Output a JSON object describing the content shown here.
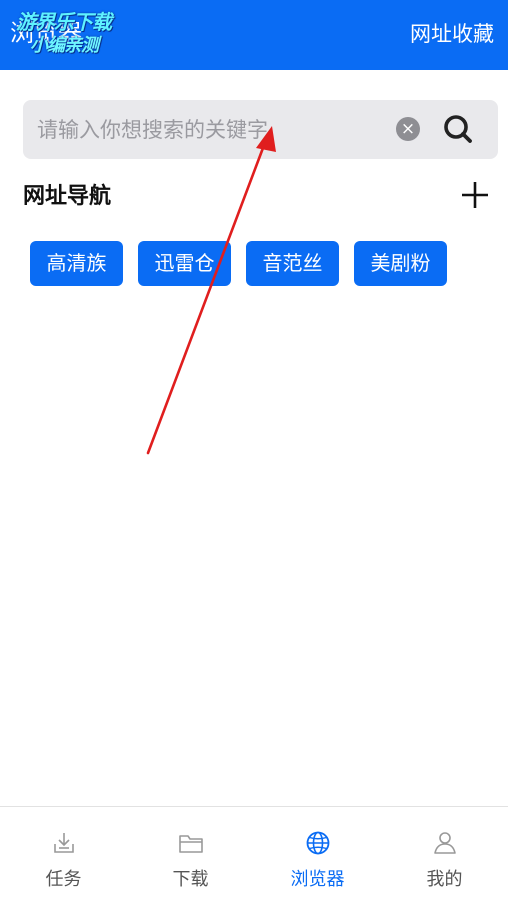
{
  "colors": {
    "accent": "#0a6cf4",
    "search_bg": "#e9e9ec",
    "arrow": "#e01e1e"
  },
  "header": {
    "title": "浏览器",
    "bookmark_label": "网址收藏",
    "watermark_line1": "游界乐下载",
    "watermark_line2": "小编亲测"
  },
  "search": {
    "placeholder": "请输入你想搜索的关键字",
    "value": "",
    "clear_icon": "clear-circle-icon",
    "search_icon": "magnifier-icon"
  },
  "nav": {
    "title": "网址导航",
    "add_icon": "plus-icon",
    "chips": [
      {
        "label": "高清族"
      },
      {
        "label": "迅雷仓"
      },
      {
        "label": "音范丝"
      },
      {
        "label": "美剧粉"
      }
    ]
  },
  "tabbar": {
    "items": [
      {
        "label": "任务",
        "icon": "task-inbox-icon",
        "active": false
      },
      {
        "label": "下载",
        "icon": "folder-icon",
        "active": false
      },
      {
        "label": "浏览器",
        "icon": "globe-icon",
        "active": true
      },
      {
        "label": "我的",
        "icon": "person-icon",
        "active": false
      }
    ]
  }
}
